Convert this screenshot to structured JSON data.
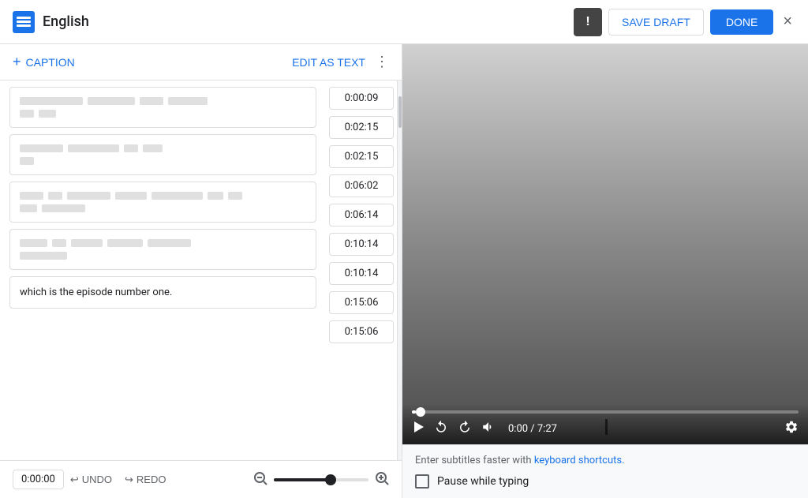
{
  "topbar": {
    "app_icon": "≡",
    "title": "English",
    "alert_label": "!",
    "save_draft_label": "SAVE DRAFT",
    "done_label": "DONE",
    "close_label": "×"
  },
  "toolbar": {
    "add_caption_label": "CAPTION",
    "edit_as_text_label": "EDIT AS TEXT",
    "more_icon": "⋮"
  },
  "captions": [
    {
      "id": 1,
      "lines": [
        [
          "long",
          "medium"
        ],
        [
          "short",
          ""
        ]
      ],
      "start": "0:00:09",
      "end": "0:02:15"
    },
    {
      "id": 2,
      "lines": [
        [
          "medium",
          "short",
          "tiny",
          "tiny"
        ],
        [
          "tiny",
          ""
        ]
      ],
      "start": "0:02:15",
      "end": "0:06:02"
    },
    {
      "id": 3,
      "lines": [
        [
          "medium",
          "tiny",
          "short",
          "medium",
          "tiny",
          "tiny"
        ],
        [
          "tiny",
          "medium"
        ]
      ],
      "start": "0:06:14",
      "end": "0:10:14"
    },
    {
      "id": 4,
      "lines": [
        [
          "short",
          "tiny",
          "short",
          "short",
          "medium"
        ],
        [
          "medium",
          ""
        ]
      ],
      "start": "0:10:14",
      "end": "0:15:06"
    },
    {
      "id": 5,
      "text": "which is the episode number one.",
      "start": "0:15:06",
      "end": ""
    }
  ],
  "bottom": {
    "time_display": "0:00:00",
    "undo_label": "UNDO",
    "redo_label": "REDO"
  },
  "video": {
    "current_time": "0:00",
    "total_time": "7:27",
    "time_display": "0:00 / 7:27"
  },
  "subtitle_hint": "Enter subtitles faster with ",
  "keyboard_shortcuts_label": "keyboard shortcuts.",
  "pause_while_typing_label": "Pause while typing"
}
